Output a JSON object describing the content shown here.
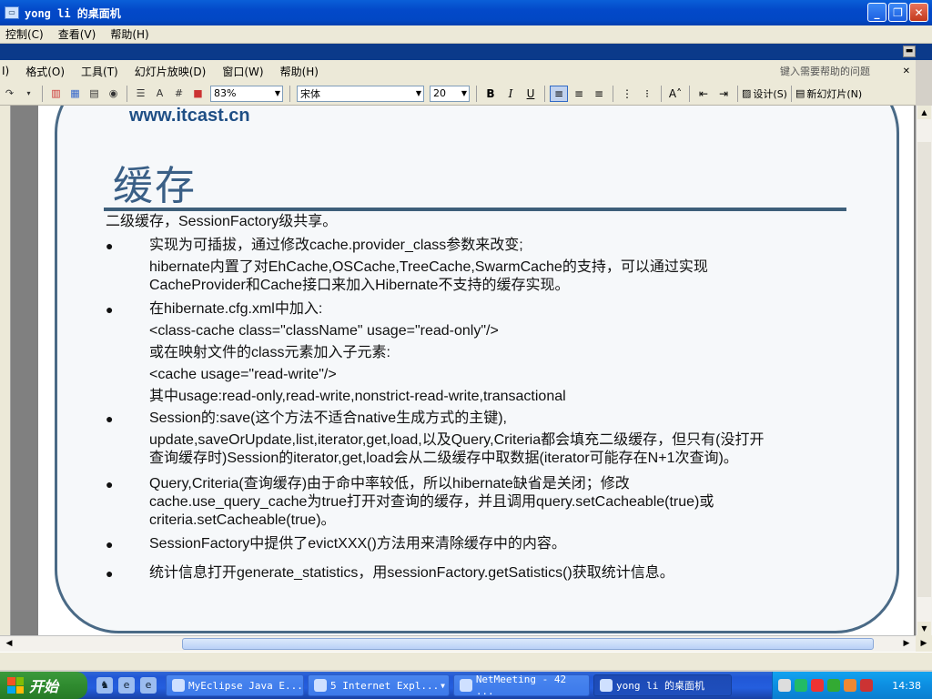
{
  "window": {
    "title": "yong li 的桌面机",
    "minimize": "_",
    "maximize": "❐",
    "close": "✕"
  },
  "outer_menu": [
    "控制(C)",
    "查看(V)",
    "帮助(H)"
  ],
  "ppt_menu": [
    "I)",
    "格式(O)",
    "工具(T)",
    "幻灯片放映(D)",
    "窗口(W)",
    "帮助(H)"
  ],
  "ppt_help_placeholder": "键入需要帮助的问题",
  "toolbar": {
    "zoom": "83%",
    "font": "宋体",
    "size": "20",
    "bold": "B",
    "italic": "I",
    "underline": "U",
    "design": "设计(S)",
    "new_slide": "新幻灯片(N)"
  },
  "slide": {
    "url": "www.itcast.cn",
    "title": "缓存",
    "intro": "二级缓存，SessionFactory级共享。",
    "bullet_char": "●",
    "b1_l1": "实现为可插拔，通过修改cache.provider_class参数来改变;",
    "b1_l2": "hibernate内置了对EhCache,OSCache,TreeCache,SwarmCache的支持，可以通过实现",
    "b1_l3": "CacheProvider和Cache接口来加入Hibernate不支持的缓存实现。",
    "b2_l1": "在hibernate.cfg.xml中加入:",
    "b2_l2": "<class-cache class=\"className\" usage=\"read-only\"/>",
    "b2_l3": "或在映射文件的class元素加入子元素:",
    "b2_l4": "<cache usage=\"read-write\"/>",
    "b2_l5": "其中usage:read-only,read-write,nonstrict-read-write,transactional",
    "b3_l1": "Session的:save(这个方法不适合native生成方式的主键),",
    "b3_l2": "update,saveOrUpdate,list,iterator,get,load,以及Query,Criteria都会填充二级缓存，但只有(没打开",
    "b3_l3": "查询缓存时)Session的iterator,get,load会从二级缓存中取数据(iterator可能存在N+1次查询)。",
    "b4_l1": "Query,Criteria(查询缓存)由于命中率较低，所以hibernate缺省是关闭；修改",
    "b4_l2": "cache.use_query_cache为true打开对查询的缓存，并且调用query.setCacheable(true)或",
    "b4_l3": "criteria.setCacheable(true)。",
    "b5_l1": "SessionFactory中提供了evictXXX()方法用来清除缓存中的内容。",
    "b6_l1": "统计信息打开generate_statistics，用sessionFactory.getSatistics()获取统计信息。"
  },
  "taskbar": {
    "start": "开始",
    "tasks": [
      {
        "label": "MyEclipse Java E..."
      },
      {
        "label": "5 Internet Expl..."
      },
      {
        "label": "NetMeeting - 42 ..."
      },
      {
        "label": "yong li 的桌面机"
      }
    ],
    "clock": "14:38"
  }
}
